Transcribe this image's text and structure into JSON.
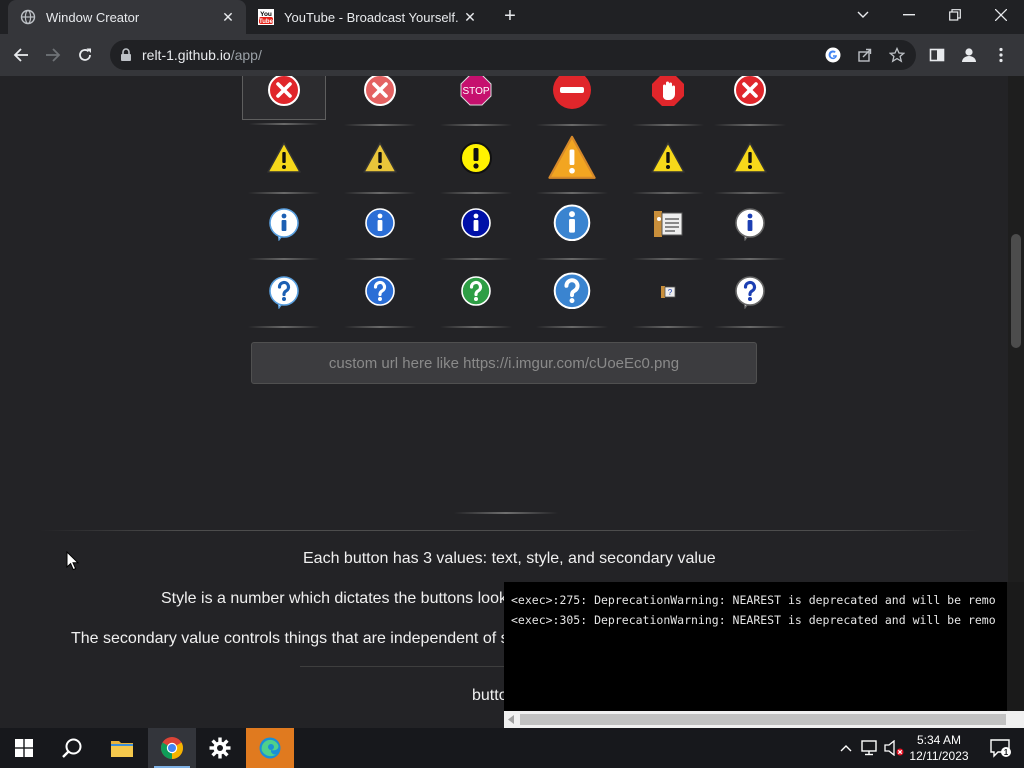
{
  "browser": {
    "tabs": [
      {
        "title": "Window Creator",
        "active": true,
        "icon": "globe-icon"
      },
      {
        "title": "YouTube - Broadcast Yourself.",
        "active": false,
        "icon": "youtube-icon",
        "favicon_text_top": "You",
        "favicon_text_bottom": "Tube"
      }
    ],
    "url_host": "relt-1.github.io",
    "url_path": "/app/"
  },
  "icon_grid": {
    "rows": [
      [
        "error-x-icon",
        "error-x-icon",
        "stop-sign-icon",
        "no-entry-icon",
        "stop-hand-icon",
        "error-x-icon"
      ],
      [
        "warning-icon",
        "warning-icon",
        "exclamation-icon",
        "warning-icon",
        "warning-icon",
        "warning-icon"
      ],
      [
        "info-icon",
        "info-icon",
        "info-icon",
        "info-icon",
        "info-document-icon",
        "info-icon"
      ],
      [
        "question-icon",
        "question-icon",
        "question-icon",
        "question-icon",
        "question-small-icon",
        "question-icon"
      ]
    ],
    "stop_text": "STOP",
    "selected_row": 0,
    "selected_col": 0
  },
  "custom_url": {
    "placeholder": "custom url here like https://i.imgur.com/cUoeEc0.png",
    "value": ""
  },
  "paragraphs": {
    "line1": "Each button has 3 values: text, style, and secondary value",
    "line2": "Style is a number which dictates the buttons look",
    "line3": "The secondary value controls things that are independent of s",
    "line4": "butto"
  },
  "console": {
    "lines": [
      "<exec>:275: DeprecationWarning: NEAREST is deprecated and will be remo",
      "<exec>:305: DeprecationWarning: NEAREST is deprecated and will be remo"
    ]
  },
  "taskbar": {
    "time": "5:34 AM",
    "date": "12/11/2023",
    "notification_count": "1"
  },
  "colors": {
    "page_bg": "#232326",
    "chrome_tab_bg": "#202124",
    "chrome_toolbar_bg": "#35363a",
    "error_red": "#e0262b",
    "warning_yellow": "#f6d81a",
    "info_blue": "#2a6fd6",
    "question_green": "#2e9e45"
  }
}
